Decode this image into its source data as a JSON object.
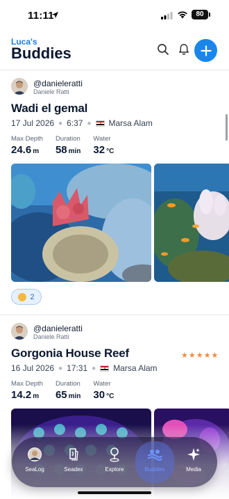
{
  "status_bar": {
    "time": "11:11",
    "battery": "80"
  },
  "header": {
    "owner": "Luca's",
    "title": "Buddies",
    "icons": [
      "search-icon",
      "bell-icon",
      "plus-icon"
    ],
    "accent": "#1a86ec"
  },
  "dives": [
    {
      "username": "@danieleratti",
      "realname": "Daniele Ratti",
      "title": "Wadi el gemal",
      "date": "17 Jul 2026",
      "time": "6:37",
      "location": "Marsa Alam",
      "stats": [
        {
          "label": "Max Depth",
          "value": "24.6",
          "unit": "m"
        },
        {
          "label": "Duration",
          "value": "58",
          "unit": "min"
        },
        {
          "label": "Water",
          "value": "32",
          "unit": "°C"
        }
      ],
      "reaction_count": "2"
    },
    {
      "username": "@danieleratti",
      "realname": "Daniele Ratti",
      "title": "Gorgonia House Reef",
      "date": "16 Jul 2026",
      "time": "17:31",
      "location": "Marsa Alam",
      "rating": 5,
      "stats": [
        {
          "label": "Max Depth",
          "value": "14.2",
          "unit": "m"
        },
        {
          "label": "Duration",
          "value": "65",
          "unit": "min"
        },
        {
          "label": "Water",
          "value": "30",
          "unit": "°C"
        }
      ]
    }
  ],
  "tabs": [
    {
      "label": "SeaLog",
      "icon": "avatar-icon"
    },
    {
      "label": "Seadex",
      "icon": "book-icon"
    },
    {
      "label": "Explore",
      "icon": "map-pin-icon"
    },
    {
      "label": "Buddies",
      "icon": "buddies-icon",
      "active": true
    },
    {
      "label": "Media",
      "icon": "sparkle-icon"
    }
  ],
  "colors": {
    "rating": "#f08a3c",
    "active_tab": "#6c93ff"
  }
}
